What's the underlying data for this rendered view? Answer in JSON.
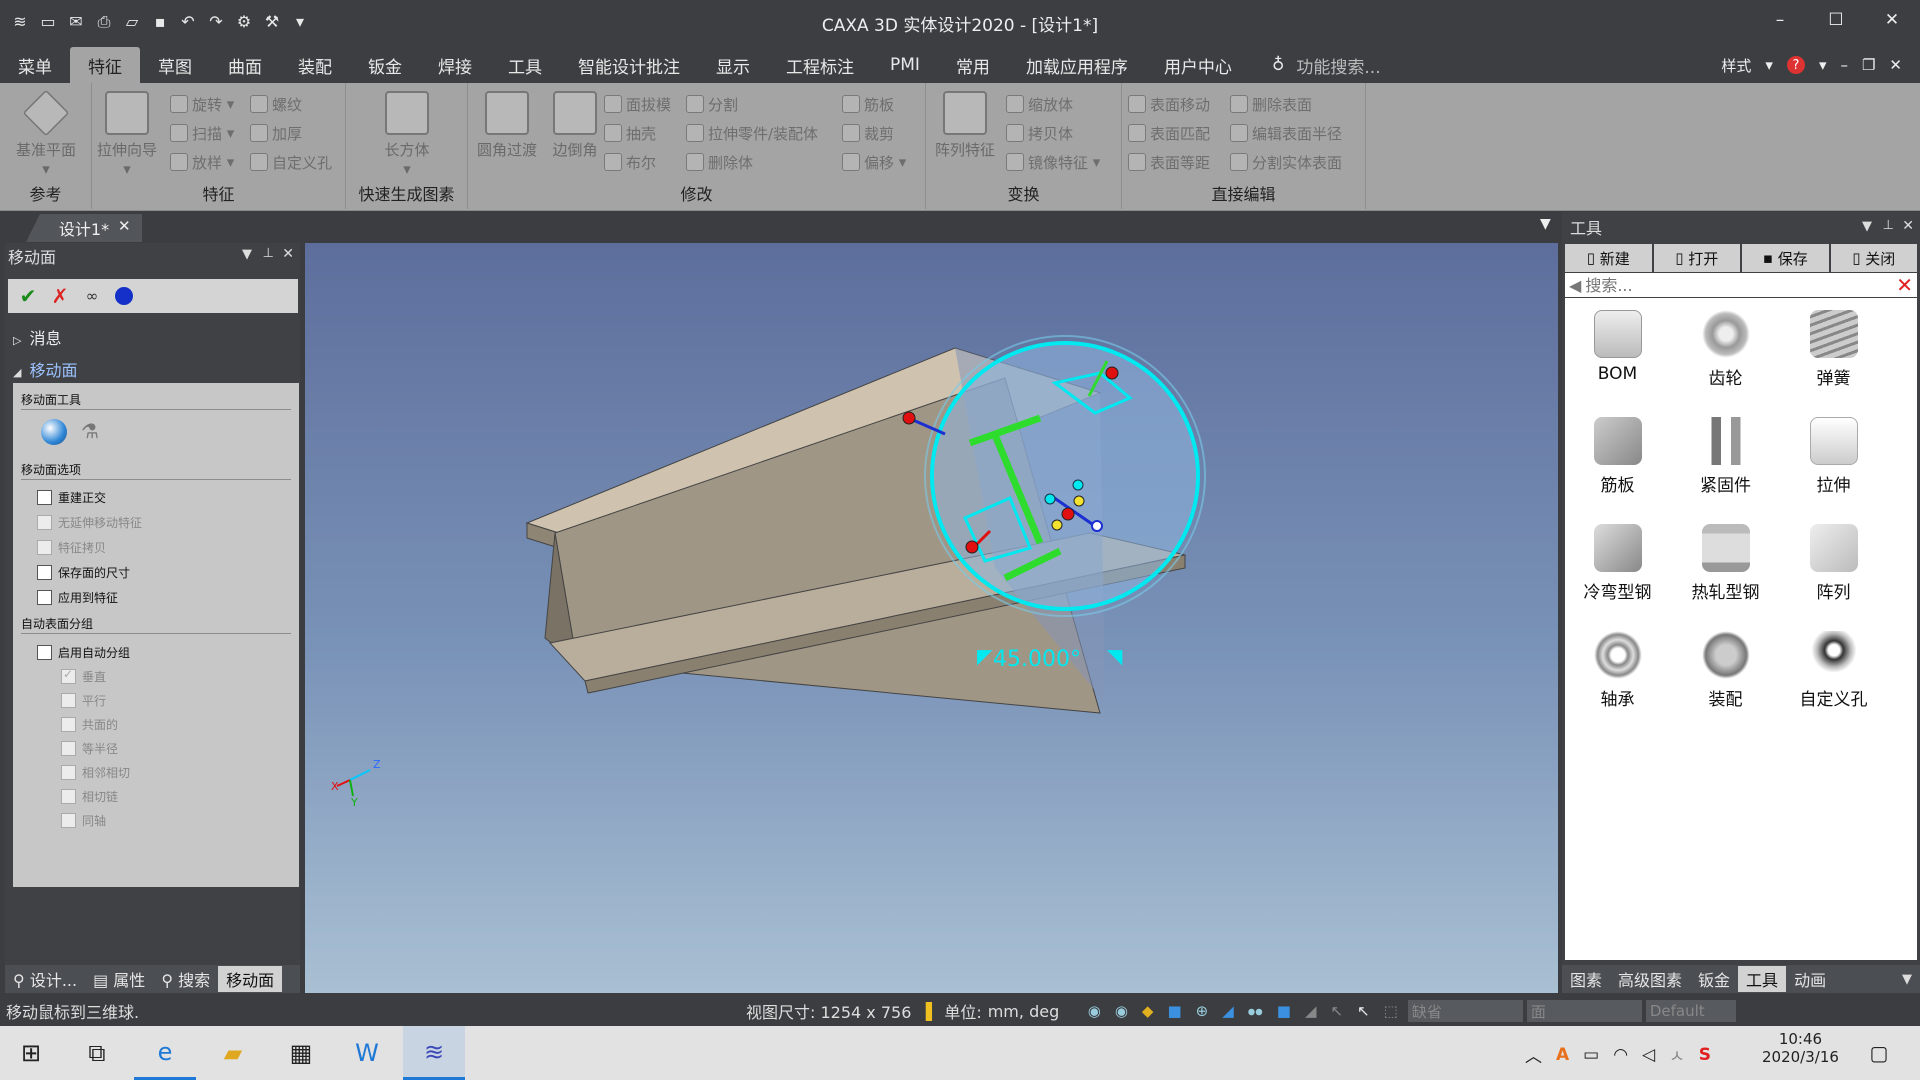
{
  "window": {
    "title": "CAXA 3D 实体设计2020 - [设计1*]",
    "minimize": "–",
    "maximize": "☐",
    "close": "✕"
  },
  "menu": {
    "tabs": [
      "菜单",
      "特征",
      "草图",
      "曲面",
      "装配",
      "钣金",
      "焊接",
      "工具",
      "智能设计批注",
      "显示",
      "工程标注",
      "PMI",
      "常用",
      "加载应用程序",
      "用户中心"
    ],
    "search_placeholder": "功能搜索...",
    "style_label": "样式"
  },
  "ribbon": {
    "groups": {
      "ref": "参考",
      "feature": "特征",
      "quick": "快速生成图素",
      "modify": "修改",
      "transform": "变换",
      "direct": "直接编辑"
    },
    "ref_items": {
      "plane": "基准平面"
    },
    "feature_items": {
      "wizard": "拉伸向导",
      "revolve": "旋转",
      "sweep": "扫描",
      "loft": "放样",
      "thread": "螺纹",
      "thicken": "加厚",
      "custom_hole": "自定义孔"
    },
    "quick_items": {
      "box": "长方体"
    },
    "modify_items": {
      "fillet": "圆角过渡",
      "chamfer": "边倒角",
      "draft": "面拔模",
      "shell": "抽壳",
      "boolean": "布尔",
      "split": "分割",
      "extend": "拉伸零件/装配体",
      "delete_body": "删除体",
      "rib": "筋板",
      "trim": "裁剪",
      "offset": "偏移"
    },
    "transform_items": {
      "pattern": "阵列特征",
      "scale": "缩放体",
      "copy": "拷贝体",
      "mirror": "镜像特征"
    },
    "direct_items": {
      "move_face": "表面移动",
      "match_face": "表面匹配",
      "offset_face": "表面等距",
      "delete_face": "删除表面",
      "edit_radius": "编辑表面半径",
      "split_body_face": "分割实体表面"
    }
  },
  "document": {
    "tab": "设计1*"
  },
  "left_panel": {
    "title": "移动面",
    "tree": {
      "messages": "消息",
      "move_face": "移动面"
    },
    "tool_section": "移动面工具",
    "options_section": "移动面选项",
    "options": [
      "重建正交",
      "无延伸移动特征",
      "特征拷贝",
      "保存面的尺寸",
      "应用到特征"
    ],
    "auto_section": "自动表面分组",
    "auto_enable": "启用自动分组",
    "auto_options": [
      "垂直",
      "平行",
      "共面的",
      "等半径",
      "相邻相切",
      "相切链",
      "同轴"
    ],
    "bottom_tabs": [
      "设计...",
      "属性",
      "搜索",
      "移动面"
    ]
  },
  "viewport": {
    "angle_label": "45.000°",
    "axis_x": "X",
    "axis_y": "Y",
    "axis_z": "Z"
  },
  "right_panel": {
    "title": "工具",
    "buttons": {
      "new": "新建",
      "open": "打开",
      "save": "保存",
      "close": "关闭"
    },
    "search_placeholder": "搜索...",
    "items": [
      "BOM",
      "齿轮",
      "弹簧",
      "筋板",
      "紧固件",
      "拉伸",
      "冷弯型钢",
      "热轧型钢",
      "阵列",
      "轴承",
      "装配",
      "自定义孔"
    ],
    "bottom_tabs": [
      "图素",
      "高级图素",
      "钣金",
      "工具",
      "动画"
    ]
  },
  "status": {
    "message": "移动鼠标到三维球.",
    "view_size_label": "视图尺寸: 1254 x  756",
    "unit_label": "单位:",
    "unit_value": "mm, deg",
    "combo1": "缺省",
    "combo2": "面",
    "combo3": "Default"
  },
  "taskbar": {
    "time": "10:46",
    "date": "2020/3/16"
  }
}
